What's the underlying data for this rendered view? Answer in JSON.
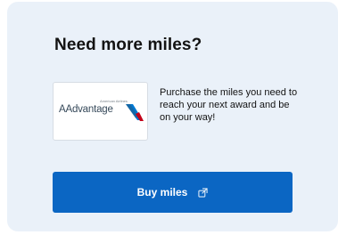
{
  "card": {
    "title": "Need more miles?",
    "logo": {
      "brand_small": "American Airlines",
      "brand_name": "AAdvantage",
      "mark_icon": "american-airlines-tail-icon"
    },
    "promo_text": "Purchase the miles you need to reach your next award and be on your way!",
    "button": {
      "label": "Buy miles",
      "icon": "external-link-icon"
    }
  },
  "colors": {
    "card_background": "#eaf1f9",
    "button_background": "#0b66c3",
    "logo_red": "#c30019",
    "logo_blue": "#0078d2"
  }
}
